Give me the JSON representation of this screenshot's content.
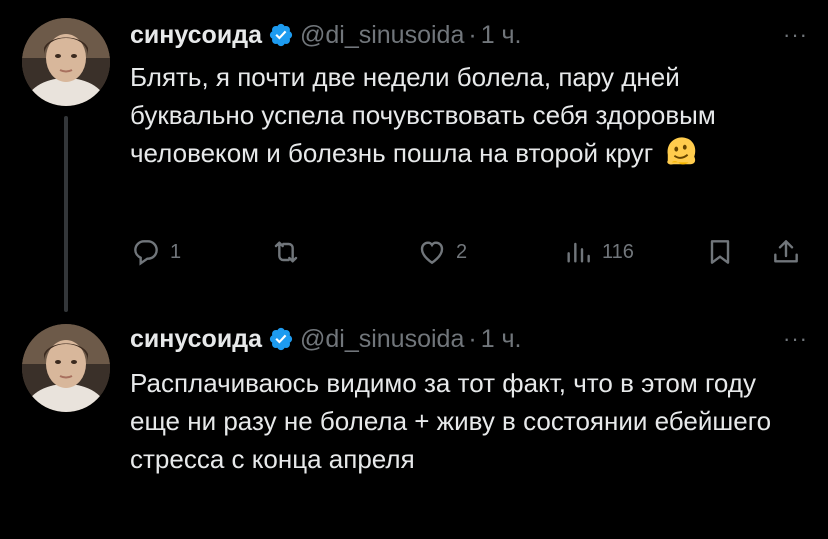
{
  "tweets": [
    {
      "name": "синусоида",
      "handle": "@di_sinusoida",
      "separator": "·",
      "time": "1 ч.",
      "more": "···",
      "text": "Блять, я почти две недели болела, пару дней буквально успела почувствовать себя здоровым человеком и болезнь пошла на второй круг",
      "emoji": "melting-face-emoji",
      "actions": {
        "reply_count": "1",
        "retweet_count": "",
        "like_count": "2",
        "views_count": "116"
      }
    },
    {
      "name": "синусоида",
      "handle": "@di_sinusoida",
      "separator": "·",
      "time": "1 ч.",
      "more": "···",
      "text": "Расплачиваюсь видимо за тот факт, что в этом году еще ни разу не болела + живу в состоянии ебейшего стресса с конца апреля"
    }
  ],
  "colors": {
    "background": "#000000",
    "text": "#e7e9ea",
    "muted": "#71767b",
    "verified": "#1d9bf0",
    "thread_line": "#333639"
  }
}
